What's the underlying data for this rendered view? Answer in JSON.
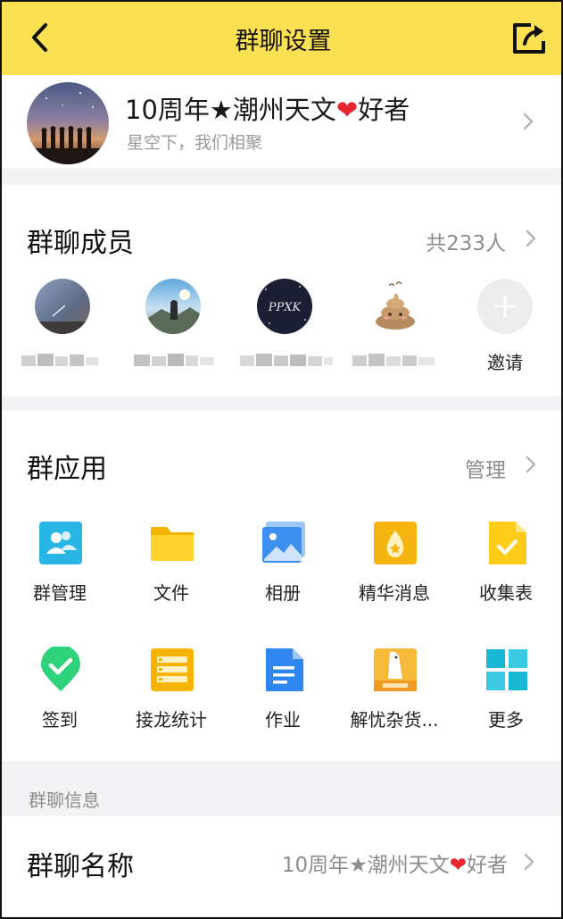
{
  "header": {
    "title": "群聊设置",
    "back_icon": "chevron-left-icon",
    "share_icon": "share-icon"
  },
  "group": {
    "name_prefix": "10周年★潮州天文",
    "heart": "❤",
    "name_suffix": "好者",
    "subtitle": "星空下，我们相聚"
  },
  "members": {
    "title": "群聊成员",
    "count_label": "共233人",
    "invite_label": "邀请"
  },
  "apps": {
    "title": "群应用",
    "manage_label": "管理",
    "items": [
      {
        "label": "群管理",
        "icon": "group-manage-icon"
      },
      {
        "label": "文件",
        "icon": "folder-icon"
      },
      {
        "label": "相册",
        "icon": "album-icon"
      },
      {
        "label": "精华消息",
        "icon": "essence-icon"
      },
      {
        "label": "收集表",
        "icon": "form-icon"
      },
      {
        "label": "签到",
        "icon": "checkin-icon"
      },
      {
        "label": "接龙统计",
        "icon": "relay-icon"
      },
      {
        "label": "作业",
        "icon": "homework-icon"
      },
      {
        "label": "解忧杂货...",
        "icon": "store-icon"
      },
      {
        "label": "更多",
        "icon": "more-grid-icon"
      }
    ]
  },
  "info": {
    "section_label": "群聊信息",
    "name_key": "群聊名称",
    "name_prefix": "10周年★潮州天文",
    "heart": "❤",
    "name_suffix": "好者"
  },
  "colors": {
    "header_bg": "#fbe051",
    "heart": "#e8262f",
    "section_bg": "#f3f3f5",
    "muted_text": "#8d8d8d"
  }
}
